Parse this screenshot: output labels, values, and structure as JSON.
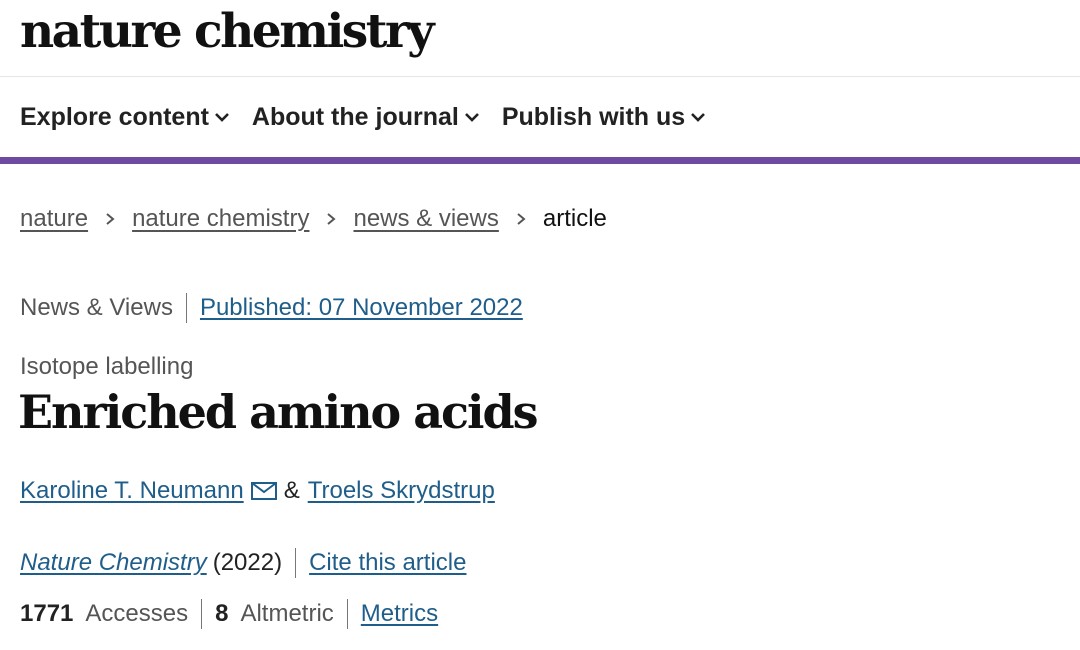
{
  "header": {
    "logo": "nature chemistry"
  },
  "nav": {
    "items": [
      {
        "label": "Explore content"
      },
      {
        "label": "About the journal"
      },
      {
        "label": "Publish with us"
      }
    ]
  },
  "breadcrumb": {
    "items": [
      "nature",
      "nature chemistry",
      "news & views"
    ],
    "current": "article"
  },
  "article": {
    "type": "News & Views",
    "published": "Published: 07 November 2022",
    "subject": "Isotope labelling",
    "title": "Enriched amino acids",
    "authors": [
      "Karoline T. Neumann",
      "Troels Skrydstrup"
    ],
    "author_separator": "&",
    "journal": "Nature Chemistry",
    "year": "(2022)",
    "cite_label": "Cite this article",
    "accesses_count": "1771",
    "accesses_label": "Accesses",
    "altmetric_count": "8",
    "altmetric_label": "Altmetric",
    "metrics_label": "Metrics"
  },
  "colors": {
    "accent_bar": "#6e4aa0",
    "link": "#1f5e8a"
  }
}
